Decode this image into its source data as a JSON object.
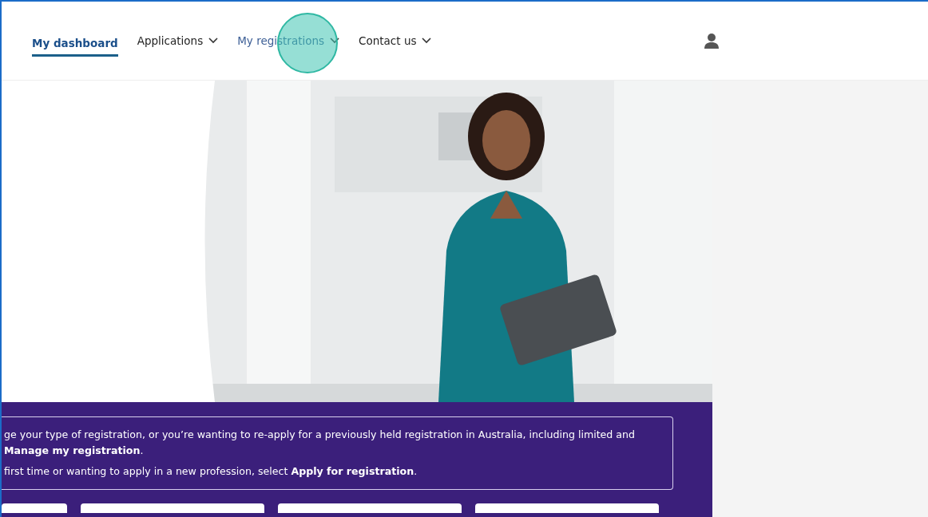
{
  "nav": {
    "items": [
      {
        "label": "My dashboard",
        "selected": true,
        "dropdown": false
      },
      {
        "label": "Applications",
        "selected": false,
        "dropdown": true
      },
      {
        "label": "My registrations",
        "selected": false,
        "dropdown": true
      },
      {
        "label": "Contact us",
        "selected": false,
        "dropdown": true
      }
    ]
  },
  "info": {
    "paragraphs": [
      "ge your type of registration, or you’re wanting to re-apply for a previously held registration in Australia, including limited and **Manage my registration**.",
      "first time or wanting to apply in a new profession, select **Apply for registration**."
    ]
  }
}
